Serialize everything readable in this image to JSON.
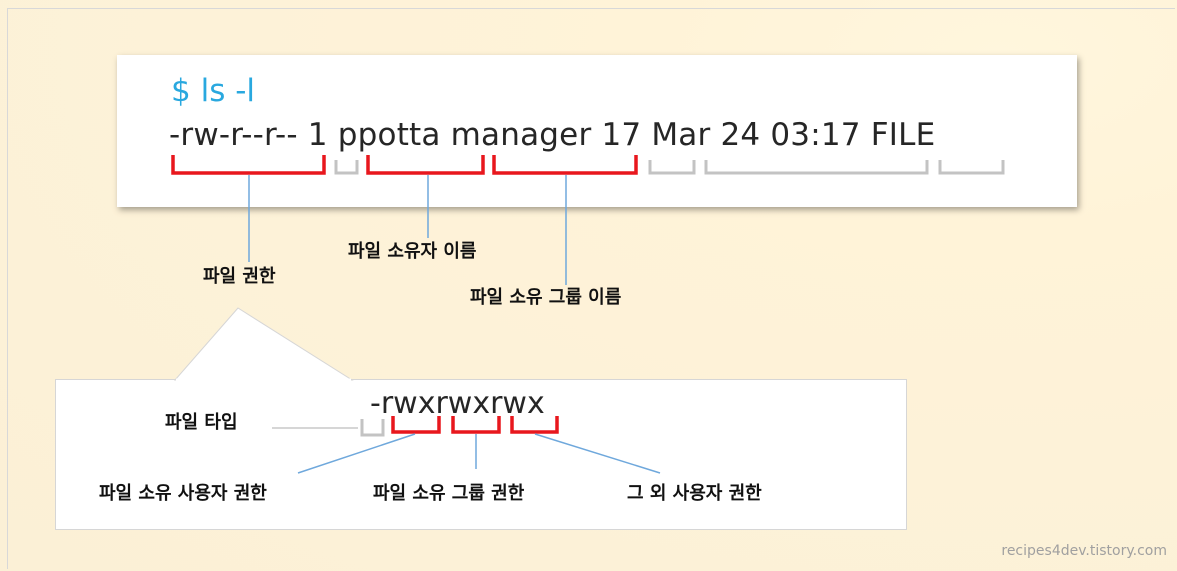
{
  "terminal": {
    "command": "$ ls -l",
    "listing_line": "-rw-r--r--  1 ppotta manager 17 Mar 24 03:17 FILE"
  },
  "labels": {
    "file_permission": "파일 권한",
    "file_owner_name": "파일 소유자 이름",
    "file_group_name": "파일 소유 그룹 이름"
  },
  "detail": {
    "permission_string": "-rwxrwxrwx",
    "file_type": "파일 타입",
    "owner_user_permission": "파일 소유 사용자 권한",
    "owner_group_permission": "파일 소유 그룹 권한",
    "other_user_permission": "그 외 사용자 권한"
  },
  "watermark": "recipes4dev.tistory.com",
  "colors": {
    "command": "#29a8df",
    "highlight_bracket": "#e8171d",
    "plain_bracket": "#c3c3c3",
    "connector_line": "#6fa8dc",
    "background": "#fdf2d8"
  }
}
